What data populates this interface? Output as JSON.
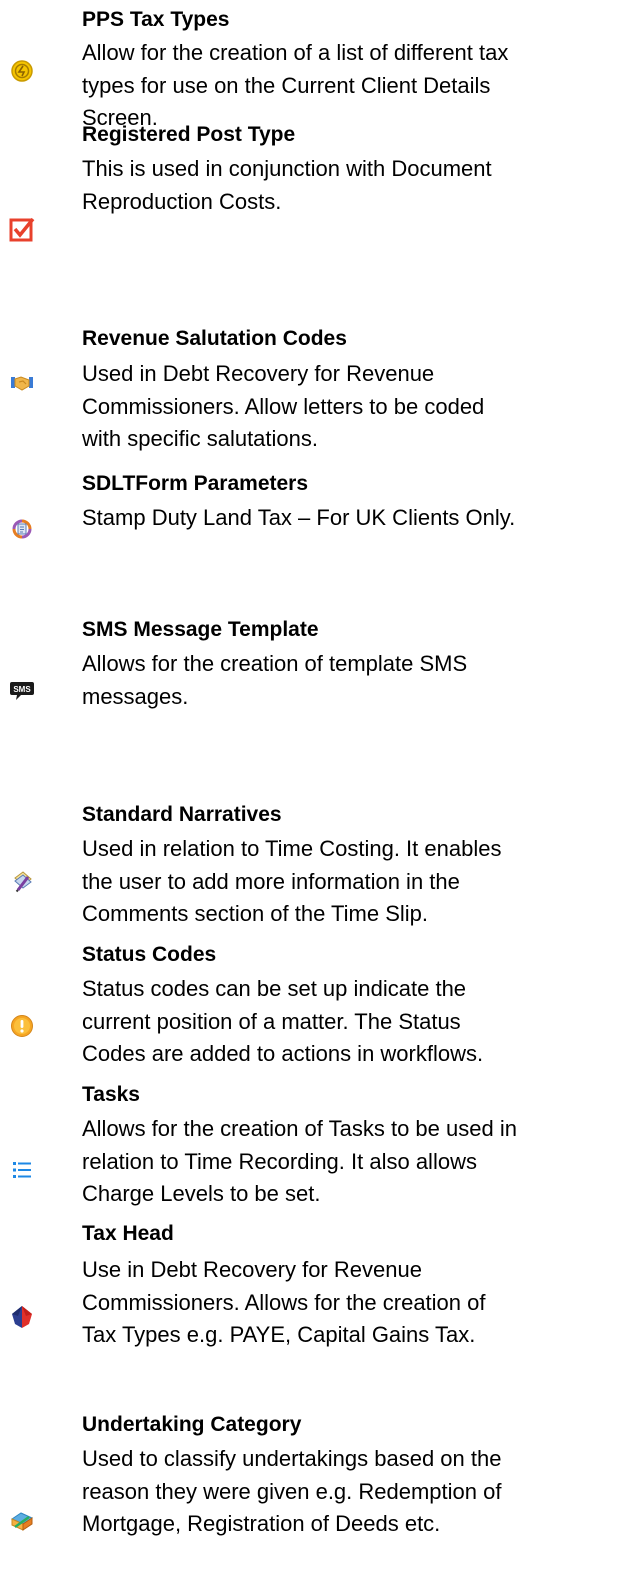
{
  "entries": [
    {
      "icon": "coin-icon",
      "title": "PPS Tax Types",
      "lines": [
        "Allow for the creation of a list of different tax",
        "types for use on the Current Client Details",
        "Screen."
      ]
    },
    {
      "icon": "checkbox-icon",
      "title": "Registered Post Type",
      "lines": [
        "This is used in conjunction with Document",
        "Reproduction Costs."
      ]
    },
    {
      "icon": "handshake-icon",
      "title": "Revenue Salutation Codes",
      "lines": [
        "Used in Debt Recovery for Revenue",
        "Commissioners.  Allow letters to be coded",
        "with specific salutations."
      ]
    },
    {
      "icon": "form-icon",
      "title": "SDLTForm Parameters",
      "lines": [
        "Stamp Duty Land Tax – For UK Clients Only."
      ]
    },
    {
      "icon": "sms-icon",
      "title": "SMS Message Template",
      "lines": [
        "Allows for the creation of template SMS",
        "messages."
      ]
    },
    {
      "icon": "pencil-notes-icon",
      "title": "Standard Narratives",
      "lines": [
        "Used in relation to Time Costing.  It enables",
        "the user to add more information in the",
        "Comments section of the Time Slip."
      ]
    },
    {
      "icon": "warning-icon",
      "title": "Status Codes",
      "lines": [
        "Status codes can be set up indicate the",
        "current position of a matter.  The Status",
        "Codes are added to actions in workflows."
      ]
    },
    {
      "icon": "task-list-icon",
      "title": "Tasks",
      "lines": [
        "Allows for the creation of Tasks to be used in",
        "relation to Time Recording.  It also allows",
        "Charge Levels to be set."
      ]
    },
    {
      "icon": "tax-head-icon",
      "title": "Tax Head",
      "lines": [
        "Use in Debt Recovery for Revenue",
        "Commissioners.  Allows for the creation of",
        "Tax Types e.g. PAYE, Capital Gains Tax."
      ]
    },
    {
      "icon": "undertaking-icon",
      "title": "Undertaking Category",
      "lines": [
        "Used to classify undertakings based on the",
        "reason they were given e.g. Redemption of",
        "Mortgage, Registration of Deeds etc."
      ]
    }
  ]
}
